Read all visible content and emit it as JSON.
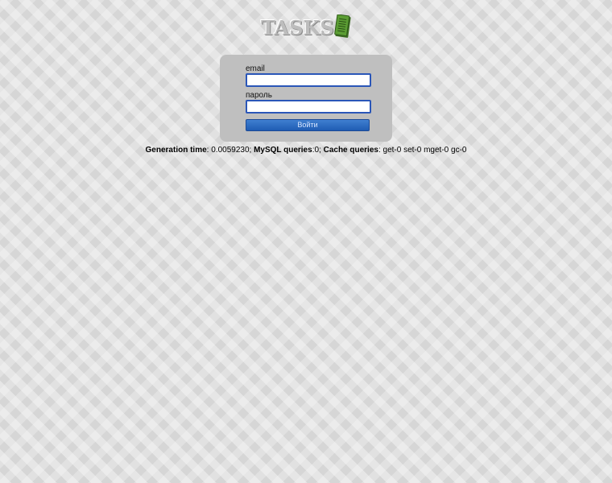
{
  "logo": {
    "text": "TASKS",
    "icon": "notepad-icon"
  },
  "login": {
    "email_label": "email",
    "email_value": "",
    "password_label": "пароль",
    "password_value": "",
    "submit_label": "Войти"
  },
  "stats": {
    "generation_label": "Generation time",
    "generation_value": ": 0.0059230;",
    "mysql_label": "MySQL queries",
    "mysql_value": ":0;",
    "cache_label": "Cache queries",
    "cache_value": ": get-0 set-0 mget-0 gc-0"
  },
  "colors": {
    "button": "#2a64be",
    "input_border": "#2a56b8",
    "box": "#bfbfbf",
    "logo_icon": "#4f8a2d"
  }
}
